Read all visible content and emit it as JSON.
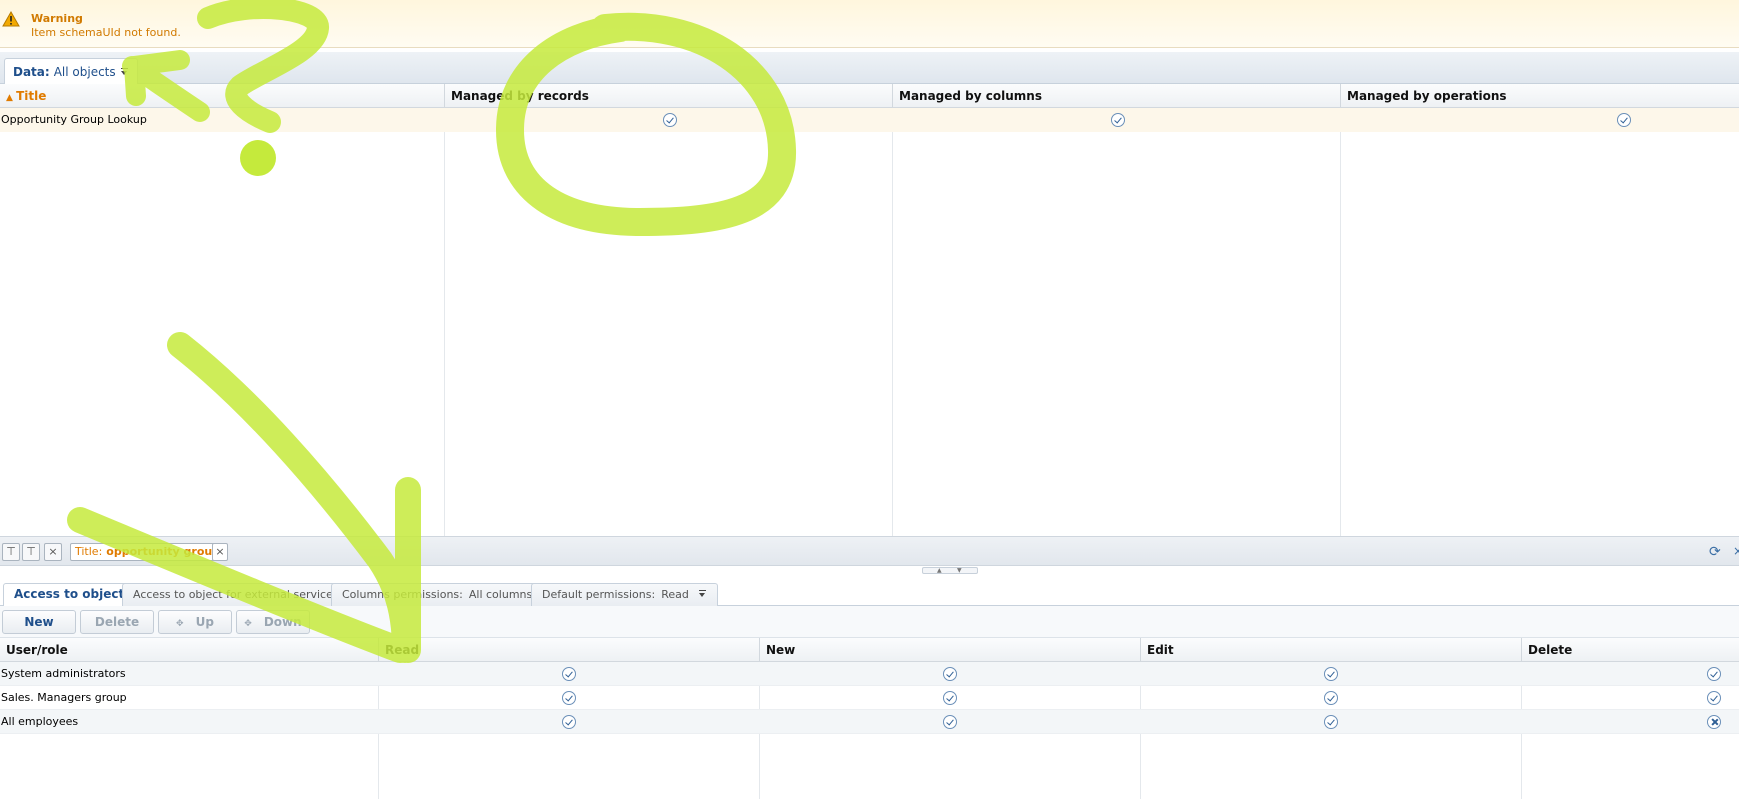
{
  "warning": {
    "title": "Warning",
    "message": "Item schemaUId not found."
  },
  "data_tab": {
    "label": "Data:",
    "value": "All objects"
  },
  "top_grid": {
    "columns": [
      "Title",
      "Managed by records",
      "Managed by columns",
      "Managed by operations"
    ],
    "rows": [
      {
        "title": "Opportunity Group Lookup",
        "records": true,
        "columns": true,
        "operations": true
      }
    ]
  },
  "filter": {
    "label": "Title:",
    "value": "opportunity group",
    "remove_symbol": "×",
    "clear_symbol": "×",
    "refresh_symbol": "⟳"
  },
  "bottom_tabs": [
    {
      "label": "Access to object",
      "value": ""
    },
    {
      "label": "Access to object for external services",
      "value": ""
    },
    {
      "label": "Columns permissions:",
      "value": "All columns"
    },
    {
      "label": "Default permissions:",
      "value": "Read"
    }
  ],
  "toolbar": {
    "new_label": "New",
    "delete_label": "Delete",
    "up_label": "Up",
    "down_label": "Down"
  },
  "bottom_grid": {
    "columns": [
      "User/role",
      "Read",
      "New",
      "Edit",
      "Delete"
    ],
    "rows": [
      {
        "role": "System administrators",
        "read": true,
        "new": true,
        "edit": true,
        "delete": true
      },
      {
        "role": "Sales. Managers group",
        "read": true,
        "new": true,
        "edit": true,
        "delete": true
      },
      {
        "role": "All employees",
        "read": true,
        "new": true,
        "edit": true,
        "delete": false
      }
    ]
  },
  "colors": {
    "accent_orange": "#e07b00",
    "link_blue": "#1f4f8b",
    "annotation_green": "#c5ea3c"
  }
}
